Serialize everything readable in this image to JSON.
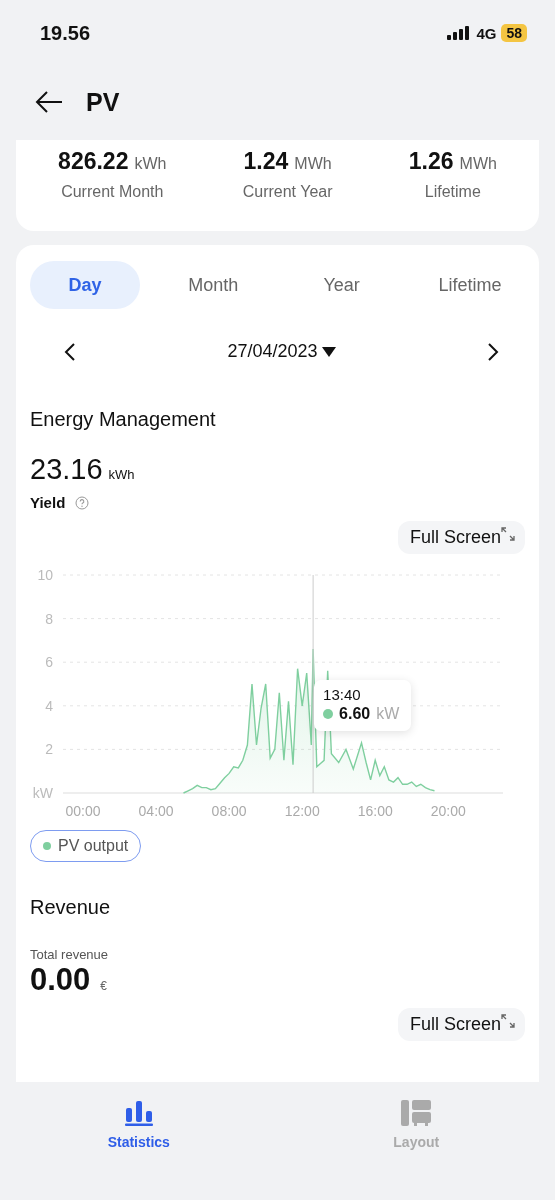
{
  "status_bar": {
    "time": "19.56",
    "network": "4G",
    "battery": "58"
  },
  "header": {
    "title": "PV"
  },
  "summary": [
    {
      "value": "826.22",
      "unit": "kWh",
      "label": "Current Month"
    },
    {
      "value": "1.24",
      "unit": "MWh",
      "label": "Current Year"
    },
    {
      "value": "1.26",
      "unit": "MWh",
      "label": "Lifetime"
    }
  ],
  "period_tabs": [
    {
      "label": "Day",
      "selected": true
    },
    {
      "label": "Month",
      "selected": false
    },
    {
      "label": "Year",
      "selected": false
    },
    {
      "label": "Lifetime",
      "selected": false
    }
  ],
  "date": {
    "value": "27/04/2023"
  },
  "energy": {
    "title": "Energy Management",
    "value": "23.16",
    "unit": "kWh",
    "label": "Yield",
    "full_screen": "Full Screen",
    "tooltip": {
      "time": "13:40",
      "value": "6.60",
      "unit": "kW"
    },
    "chart_data": {
      "type": "area",
      "x": [
        5.5,
        5.75,
        6,
        6.25,
        6.5,
        6.75,
        7,
        7.25,
        7.5,
        7.75,
        8,
        8.25,
        8.5,
        8.75,
        9,
        9.25,
        9.5,
        9.75,
        10,
        10.25,
        10.5,
        10.75,
        11,
        11.25,
        11.5,
        11.75,
        12,
        12.25,
        12.5,
        12.6,
        12.8,
        13,
        13.2,
        13.4,
        13.6,
        13.8,
        14,
        14.2,
        14.4,
        14.6,
        14.8,
        15,
        15.25,
        15.5,
        15.75,
        16,
        16.25,
        16.5,
        16.75,
        17,
        17.25,
        17.5,
        17.75,
        18,
        18.25,
        18.5,
        18.75,
        19,
        19.25
      ],
      "series": [
        {
          "name": "PV output",
          "color": "#7fcf9f",
          "values": [
            0,
            0.1,
            0.2,
            0.35,
            0.25,
            0.25,
            0.15,
            0.2,
            0.45,
            0.7,
            0.9,
            1.2,
            1.15,
            1.5,
            2.2,
            5.0,
            2.2,
            3.9,
            5.0,
            1.6,
            2.0,
            4.6,
            1.5,
            4.2,
            1.3,
            5.7,
            4.0,
            5.5,
            2.2,
            6.6,
            1.2,
            null,
            1.5,
            5.6,
            1.8,
            null,
            1.4,
            null,
            2.0,
            null,
            1.1,
            null,
            2.3,
            1.4,
            0.6,
            1.5,
            0.8,
            1.2,
            0.6,
            0.5,
            0.7,
            0.4,
            0.4,
            0.5,
            0.3,
            0.4,
            0.25,
            0.15,
            0.1
          ]
        }
      ],
      "xlim": [
        -1.1,
        23
      ],
      "ylim": [
        0,
        10
      ],
      "grid": true,
      "ref_lines": [
        {
          "axis": "x",
          "value": 12.6
        }
      ],
      "xticks": [
        {
          "value": 0,
          "label": "00:00"
        },
        {
          "value": 4,
          "label": "04:00"
        },
        {
          "value": 8,
          "label": "08:00"
        },
        {
          "value": 12,
          "label": "12:00"
        },
        {
          "value": 16,
          "label": "16:00"
        },
        {
          "value": 20,
          "label": "20:00"
        }
      ],
      "yticks": [
        {
          "value": 0,
          "label": "kW"
        },
        2,
        4,
        6,
        8,
        10
      ]
    },
    "legend": [
      {
        "on": true
      }
    ]
  },
  "revenue": {
    "title": "Revenue",
    "label": "Total revenue",
    "value": "0.00",
    "unit": "€",
    "full_screen": "Full Screen"
  },
  "bottom_nav": [
    {
      "label": "Statistics",
      "selected": true
    },
    {
      "label": "Layout",
      "selected": false
    }
  ]
}
